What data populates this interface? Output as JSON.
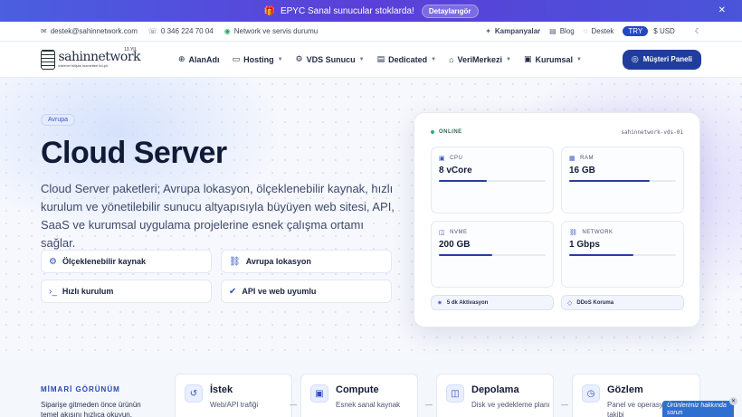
{
  "announcement": {
    "text": "EPYC Sanal sunucular stoklarda!",
    "button": "Detaylarıgör",
    "icon": "gift-icon",
    "close_icon": "close-icon"
  },
  "infobar": {
    "email": "destek@sahinnetwork.com",
    "phone": "0 346 224 70 04",
    "status": "Network ve servis durumu",
    "campaigns": "Kampanyalar",
    "blog": "Blog",
    "support": "Destek",
    "currencies": [
      "TRY",
      "$ USD"
    ]
  },
  "logo": {
    "name": "sahinnetwork",
    "subtitle": "internet bilişim hizmetleri ltd.şti.",
    "years": "13.YIL"
  },
  "nav": {
    "items": [
      {
        "label": "AlanAdı",
        "icon": "globe-icon",
        "dropdown": false
      },
      {
        "label": "Hosting",
        "icon": "server-icon",
        "dropdown": true
      },
      {
        "label": "VDS Sunucu",
        "icon": "cpu-icon",
        "dropdown": true
      },
      {
        "label": "Dedicated",
        "icon": "database-icon",
        "dropdown": true
      },
      {
        "label": "VeriMerkezi",
        "icon": "building-icon",
        "dropdown": true
      },
      {
        "label": "Kurumsal",
        "icon": "briefcase-icon",
        "dropdown": true
      }
    ],
    "panel_button": "Müşteri Paneli"
  },
  "hero": {
    "tag": "Avrupa",
    "title": "Cloud Server",
    "lead": "Cloud Server paketleri; Avrupa lokasyon, ölçeklenebilir kaynak, hızlı kurulum ve yönetilebilir sunucu altyapısıyla büyüyen web sitesi, API, SaaS ve kurumsal uygulama projelerine esnek çalışma ortamı sağlar.",
    "features": [
      {
        "label": "Ölçeklenebilir kaynak",
        "icon": "scale-icon"
      },
      {
        "label": "Avrupa lokasyon",
        "icon": "network-icon"
      },
      {
        "label": "Hızlı kurulum",
        "icon": "terminal-icon"
      },
      {
        "label": "API ve web uyumlu",
        "icon": "check-circle-icon"
      }
    ]
  },
  "server_card": {
    "status": "ONLINE",
    "hostname": "sahinnetwork-vds-01",
    "stats": [
      {
        "label": "CPU",
        "value": "8 vCore",
        "usage": 0.45,
        "icon": "cpu-icon"
      },
      {
        "label": "RAM",
        "value": "16 GB",
        "usage": 0.75,
        "icon": "memory-icon"
      },
      {
        "label": "NVME",
        "value": "200 GB",
        "usage": 0.5,
        "icon": "disk-icon"
      },
      {
        "label": "NETWORK",
        "value": "1 Gbps",
        "usage": 0.6,
        "icon": "network-icon"
      }
    ],
    "chips": [
      {
        "label": "5 dk Aktivasyon",
        "icon": "spark-icon"
      },
      {
        "label": "DDoS Koruma",
        "icon": "shield-icon"
      }
    ]
  },
  "architecture": {
    "title": "MİMARİ GÖRÜNÜM",
    "description": "Siparişe gitmeden önce ürünün temel akışını hızlıca okuyun.",
    "steps": [
      {
        "title": "İstek",
        "desc": "Web/API trafiği",
        "icon": "request-icon"
      },
      {
        "title": "Compute",
        "desc": "Esnek sanal kaynak",
        "icon": "chip-icon"
      },
      {
        "title": "Depolama",
        "desc": "Disk ve yedekleme planı",
        "icon": "storage-icon"
      },
      {
        "title": "Gözlem",
        "desc": "Panel ve operasyon takibi",
        "icon": "clock-icon"
      }
    ]
  },
  "chat_widget": {
    "text": "Ürünlerimiz hakkında sorun"
  },
  "colors": {
    "accent": "#213d9c",
    "announce": "#5a3fd8",
    "online": "#22b573"
  }
}
